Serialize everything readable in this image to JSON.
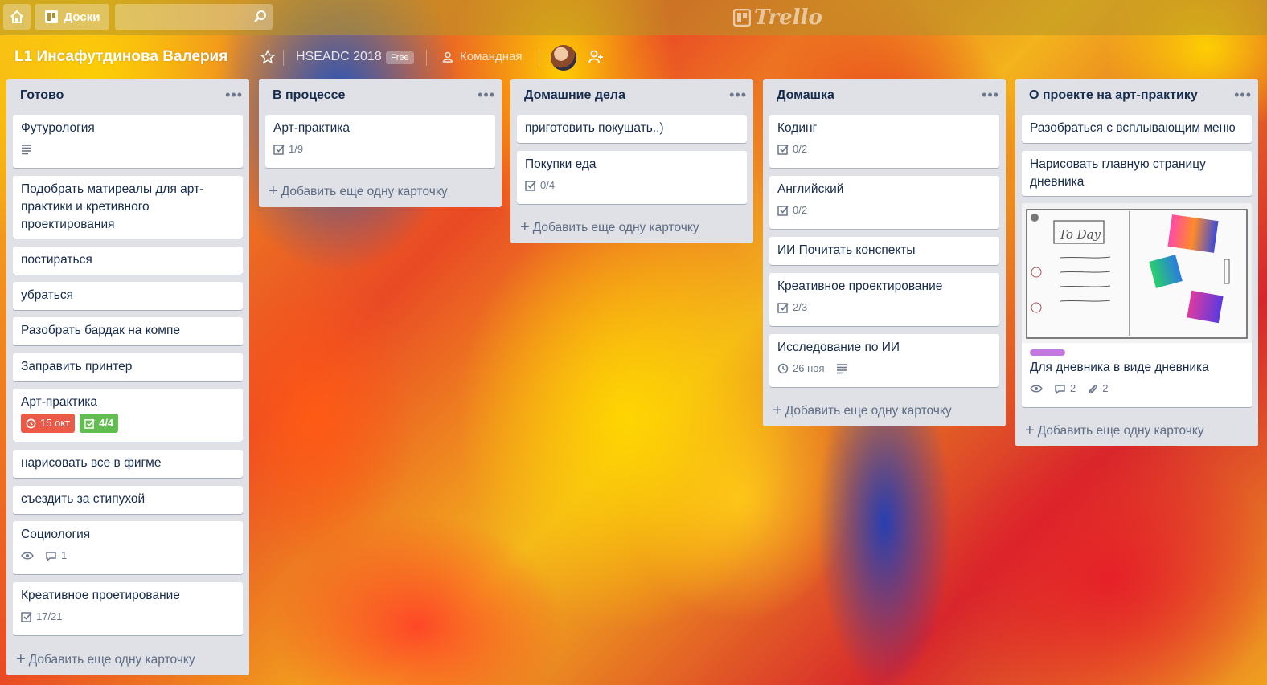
{
  "header": {
    "boards_label": "Доски",
    "logo_text": "Trello"
  },
  "board": {
    "title": "L1 Инсафутдинова Валерия",
    "team": "HSEADC 2018",
    "plan_badge": "Free",
    "visibility": "Командная"
  },
  "add_card_label": "Добавить еще одну карточку",
  "lists": [
    {
      "title": "Готово",
      "cards": [
        {
          "title": "Футурология"
        },
        {
          "title": "Подобрать матиреалы для арт-практики и кретивного проектирования"
        },
        {
          "title": "постираться"
        },
        {
          "title": "убраться"
        },
        {
          "title": "Разобрать бардак на компе"
        },
        {
          "title": "Заправить принтер"
        },
        {
          "title": "Арт-практика",
          "due": "15 окт",
          "checklist": "4/4"
        },
        {
          "title": "нарисовать все в фигме"
        },
        {
          "title": "съездить за стипухой"
        },
        {
          "title": "Социология",
          "comments": "1"
        },
        {
          "title": "Креативное проетирование",
          "checklist": "17/21"
        }
      ]
    },
    {
      "title": "В процессе",
      "cards": [
        {
          "title": "Арт-практика",
          "checklist": "1/9"
        }
      ]
    },
    {
      "title": "Домашние дела",
      "cards": [
        {
          "title": "приготовить покушать..)"
        },
        {
          "title": "Покупки еда",
          "checklist": "0/4"
        }
      ]
    },
    {
      "title": "Домашка",
      "cards": [
        {
          "title": "Кодинг",
          "checklist": "0/2"
        },
        {
          "title": "Английский",
          "checklist": "0/2"
        },
        {
          "title": "ИИ Почитать конспекты"
        },
        {
          "title": "Креативное проектирование",
          "checklist": "2/3"
        },
        {
          "title": "Исследование по ИИ",
          "due": "26 ноя"
        }
      ]
    },
    {
      "title": "О проекте на арт-практику",
      "cards": [
        {
          "title": "Разобраться с всплывающим меню"
        },
        {
          "title": "Нарисовать главную страницу дневника"
        },
        {
          "title": "Для дневника в виде дневника",
          "cover_text": "To Day",
          "comments": "2",
          "attachments": "2"
        }
      ]
    }
  ],
  "colors": {
    "list_bg": "#dfe1e6",
    "due_overdue": "#eb5a46",
    "checklist_done": "#61bd4f",
    "label_purple": "#c377e0"
  },
  "icons": [
    "home-icon",
    "boards-icon",
    "search-icon",
    "star-icon",
    "team-icon",
    "invite-icon",
    "description-icon",
    "checklist-icon",
    "clock-icon",
    "eye-icon",
    "comment-icon",
    "attachment-icon",
    "menu-icon"
  ]
}
